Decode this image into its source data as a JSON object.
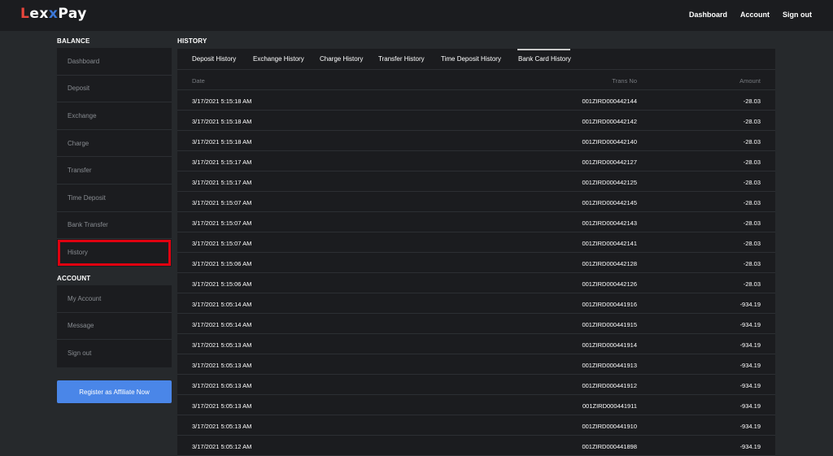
{
  "header": {
    "logo": {
      "part1": "L",
      "part2": "ex",
      "part3": "x",
      "part4": "Pay"
    },
    "nav": [
      "Dashboard",
      "Account",
      "Sign out"
    ]
  },
  "sidebar": {
    "balance_title": "BALANCE",
    "balance_items": [
      "Dashboard",
      "Deposit",
      "Exchange",
      "Charge",
      "Transfer",
      "Time Deposit",
      "Bank Transfer",
      "History"
    ],
    "highlighted_item": "History",
    "account_title": "ACCOUNT",
    "account_items": [
      "My Account",
      "Message",
      "Sign out"
    ],
    "affiliate_button": "Register as Affiliate Now"
  },
  "main": {
    "title": "HISTORY",
    "tabs": [
      "Deposit History",
      "Exchange History",
      "Charge History",
      "Transfer History",
      "Time Deposit History",
      "Bank Card History"
    ],
    "active_tab": "Bank Card History",
    "columns": {
      "date": "Date",
      "trans_no": "Trans No",
      "amount": "Amount"
    },
    "rows": [
      {
        "date": "3/17/2021 5:15:18 AM",
        "trans_no": "001ZIRD000442144",
        "amount": "-28.03"
      },
      {
        "date": "3/17/2021 5:15:18 AM",
        "trans_no": "001ZIRD000442142",
        "amount": "-28.03"
      },
      {
        "date": "3/17/2021 5:15:18 AM",
        "trans_no": "001ZIRD000442140",
        "amount": "-28.03"
      },
      {
        "date": "3/17/2021 5:15:17 AM",
        "trans_no": "001ZIRD000442127",
        "amount": "-28.03"
      },
      {
        "date": "3/17/2021 5:15:17 AM",
        "trans_no": "001ZIRD000442125",
        "amount": "-28.03"
      },
      {
        "date": "3/17/2021 5:15:07 AM",
        "trans_no": "001ZIRD000442145",
        "amount": "-28.03"
      },
      {
        "date": "3/17/2021 5:15:07 AM",
        "trans_no": "001ZIRD000442143",
        "amount": "-28.03"
      },
      {
        "date": "3/17/2021 5:15:07 AM",
        "trans_no": "001ZIRD000442141",
        "amount": "-28.03"
      },
      {
        "date": "3/17/2021 5:15:06 AM",
        "trans_no": "001ZIRD000442128",
        "amount": "-28.03"
      },
      {
        "date": "3/17/2021 5:15:06 AM",
        "trans_no": "001ZIRD000442126",
        "amount": "-28.03"
      },
      {
        "date": "3/17/2021 5:05:14 AM",
        "trans_no": "001ZIRD000441916",
        "amount": "-934.19"
      },
      {
        "date": "3/17/2021 5:05:14 AM",
        "trans_no": "001ZIRD000441915",
        "amount": "-934.19"
      },
      {
        "date": "3/17/2021 5:05:13 AM",
        "trans_no": "001ZIRD000441914",
        "amount": "-934.19"
      },
      {
        "date": "3/17/2021 5:05:13 AM",
        "trans_no": "001ZIRD000441913",
        "amount": "-934.19"
      },
      {
        "date": "3/17/2021 5:05:13 AM",
        "trans_no": "001ZIRD000441912",
        "amount": "-934.19"
      },
      {
        "date": "3/17/2021 5:05:13 AM",
        "trans_no": "001ZIRD000441911",
        "amount": "-934.19"
      },
      {
        "date": "3/17/2021 5:05:13 AM",
        "trans_no": "001ZIRD000441910",
        "amount": "-934.19"
      },
      {
        "date": "3/17/2021 5:05:12 AM",
        "trans_no": "001ZIRD000441898",
        "amount": "-934.19"
      }
    ]
  },
  "colors": {
    "background": "#26292c",
    "panel": "#1b1c1f",
    "accent_button": "#4a86e8",
    "highlight_box": "#e00010",
    "logo_red": "#e8453c",
    "logo_blue": "#3c78d8"
  }
}
